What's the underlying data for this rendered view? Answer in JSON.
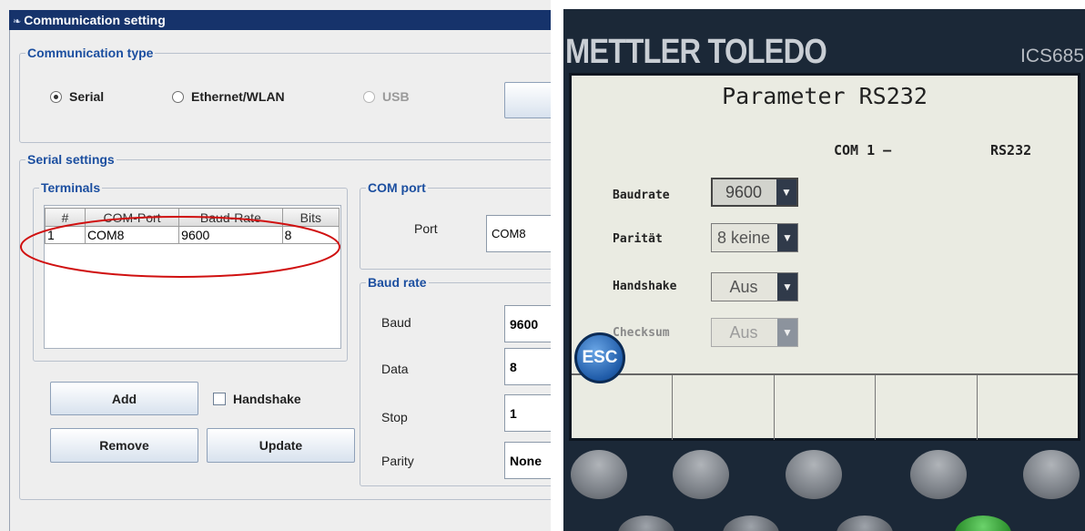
{
  "dialog": {
    "title": "Communication setting",
    "comm_type": {
      "legend": "Communication type",
      "options": [
        {
          "label": "Serial",
          "selected": true,
          "enabled": true
        },
        {
          "label": "Ethernet/WLAN",
          "selected": false,
          "enabled": true
        },
        {
          "label": "USB",
          "selected": false,
          "enabled": false
        }
      ]
    },
    "serial": {
      "legend": "Serial settings",
      "terminals": {
        "legend": "Terminals",
        "columns": [
          "#",
          "COM-Port",
          "Baud-Rate",
          "Bits"
        ],
        "rows": [
          [
            "1",
            "COM8",
            "9600",
            "8"
          ]
        ]
      },
      "com_port": {
        "legend": "COM port",
        "port_label": "Port",
        "port_value": "COM8"
      },
      "baud_rate": {
        "legend": "Baud rate",
        "baud_label": "Baud",
        "baud_value": "9600",
        "data_label": "Data",
        "data_value": "8",
        "stop_label": "Stop",
        "stop_value": "1",
        "parity_label": "Parity",
        "parity_value": "None"
      },
      "buttons": {
        "add": "Add",
        "remove": "Remove",
        "update": "Update"
      },
      "handshake_label": "Handshake",
      "handshake_checked": false
    }
  },
  "terminal": {
    "brand": "METTLER TOLEDO",
    "model": "ICS685",
    "screen_title": "Parameter RS232",
    "com": "COM 1 –",
    "interface": "RS232",
    "params": [
      {
        "label": "Baudrate",
        "value": "9600",
        "enabled": true,
        "selected": true
      },
      {
        "label": "Parität",
        "value": "8 keine",
        "enabled": true,
        "selected": false
      },
      {
        "label": "Handshake",
        "value": "Aus",
        "enabled": true,
        "selected": false
      },
      {
        "label": "Checksum",
        "value": "Aus",
        "enabled": false,
        "selected": false
      }
    ],
    "esc_label": "ESC"
  },
  "colors": {
    "titlebar": "#16336b",
    "legend_text": "#1c4fa0",
    "highlight_ellipse": "#d01010",
    "terminal_body": "#1b2837",
    "terminal_screen": "#eaebe2"
  }
}
